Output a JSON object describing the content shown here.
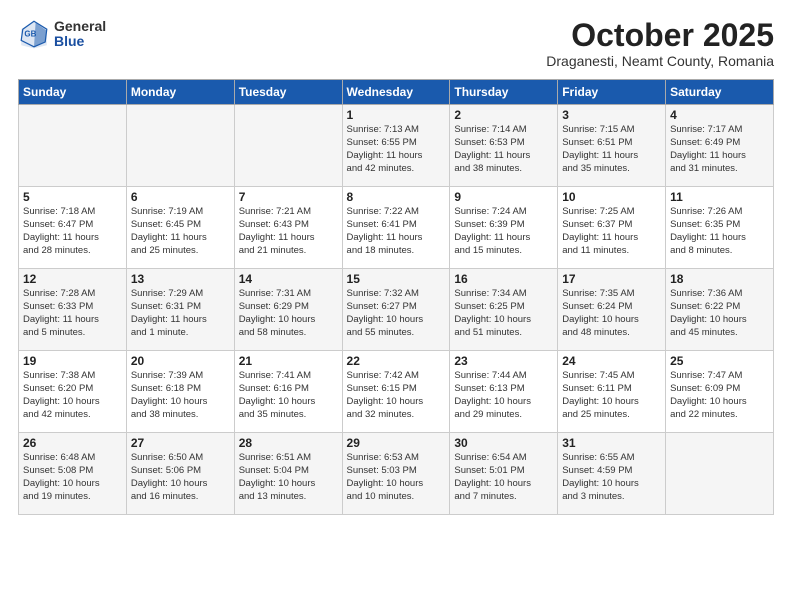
{
  "header": {
    "logo_general": "General",
    "logo_blue": "Blue",
    "month": "October 2025",
    "location": "Draganesti, Neamt County, Romania"
  },
  "weekdays": [
    "Sunday",
    "Monday",
    "Tuesday",
    "Wednesday",
    "Thursday",
    "Friday",
    "Saturday"
  ],
  "weeks": [
    [
      {
        "day": "",
        "lines": []
      },
      {
        "day": "",
        "lines": []
      },
      {
        "day": "",
        "lines": []
      },
      {
        "day": "1",
        "lines": [
          "Sunrise: 7:13 AM",
          "Sunset: 6:55 PM",
          "Daylight: 11 hours",
          "and 42 minutes."
        ]
      },
      {
        "day": "2",
        "lines": [
          "Sunrise: 7:14 AM",
          "Sunset: 6:53 PM",
          "Daylight: 11 hours",
          "and 38 minutes."
        ]
      },
      {
        "day": "3",
        "lines": [
          "Sunrise: 7:15 AM",
          "Sunset: 6:51 PM",
          "Daylight: 11 hours",
          "and 35 minutes."
        ]
      },
      {
        "day": "4",
        "lines": [
          "Sunrise: 7:17 AM",
          "Sunset: 6:49 PM",
          "Daylight: 11 hours",
          "and 31 minutes."
        ]
      }
    ],
    [
      {
        "day": "5",
        "lines": [
          "Sunrise: 7:18 AM",
          "Sunset: 6:47 PM",
          "Daylight: 11 hours",
          "and 28 minutes."
        ]
      },
      {
        "day": "6",
        "lines": [
          "Sunrise: 7:19 AM",
          "Sunset: 6:45 PM",
          "Daylight: 11 hours",
          "and 25 minutes."
        ]
      },
      {
        "day": "7",
        "lines": [
          "Sunrise: 7:21 AM",
          "Sunset: 6:43 PM",
          "Daylight: 11 hours",
          "and 21 minutes."
        ]
      },
      {
        "day": "8",
        "lines": [
          "Sunrise: 7:22 AM",
          "Sunset: 6:41 PM",
          "Daylight: 11 hours",
          "and 18 minutes."
        ]
      },
      {
        "day": "9",
        "lines": [
          "Sunrise: 7:24 AM",
          "Sunset: 6:39 PM",
          "Daylight: 11 hours",
          "and 15 minutes."
        ]
      },
      {
        "day": "10",
        "lines": [
          "Sunrise: 7:25 AM",
          "Sunset: 6:37 PM",
          "Daylight: 11 hours",
          "and 11 minutes."
        ]
      },
      {
        "day": "11",
        "lines": [
          "Sunrise: 7:26 AM",
          "Sunset: 6:35 PM",
          "Daylight: 11 hours",
          "and 8 minutes."
        ]
      }
    ],
    [
      {
        "day": "12",
        "lines": [
          "Sunrise: 7:28 AM",
          "Sunset: 6:33 PM",
          "Daylight: 11 hours",
          "and 5 minutes."
        ]
      },
      {
        "day": "13",
        "lines": [
          "Sunrise: 7:29 AM",
          "Sunset: 6:31 PM",
          "Daylight: 11 hours",
          "and 1 minute."
        ]
      },
      {
        "day": "14",
        "lines": [
          "Sunrise: 7:31 AM",
          "Sunset: 6:29 PM",
          "Daylight: 10 hours",
          "and 58 minutes."
        ]
      },
      {
        "day": "15",
        "lines": [
          "Sunrise: 7:32 AM",
          "Sunset: 6:27 PM",
          "Daylight: 10 hours",
          "and 55 minutes."
        ]
      },
      {
        "day": "16",
        "lines": [
          "Sunrise: 7:34 AM",
          "Sunset: 6:25 PM",
          "Daylight: 10 hours",
          "and 51 minutes."
        ]
      },
      {
        "day": "17",
        "lines": [
          "Sunrise: 7:35 AM",
          "Sunset: 6:24 PM",
          "Daylight: 10 hours",
          "and 48 minutes."
        ]
      },
      {
        "day": "18",
        "lines": [
          "Sunrise: 7:36 AM",
          "Sunset: 6:22 PM",
          "Daylight: 10 hours",
          "and 45 minutes."
        ]
      }
    ],
    [
      {
        "day": "19",
        "lines": [
          "Sunrise: 7:38 AM",
          "Sunset: 6:20 PM",
          "Daylight: 10 hours",
          "and 42 minutes."
        ]
      },
      {
        "day": "20",
        "lines": [
          "Sunrise: 7:39 AM",
          "Sunset: 6:18 PM",
          "Daylight: 10 hours",
          "and 38 minutes."
        ]
      },
      {
        "day": "21",
        "lines": [
          "Sunrise: 7:41 AM",
          "Sunset: 6:16 PM",
          "Daylight: 10 hours",
          "and 35 minutes."
        ]
      },
      {
        "day": "22",
        "lines": [
          "Sunrise: 7:42 AM",
          "Sunset: 6:15 PM",
          "Daylight: 10 hours",
          "and 32 minutes."
        ]
      },
      {
        "day": "23",
        "lines": [
          "Sunrise: 7:44 AM",
          "Sunset: 6:13 PM",
          "Daylight: 10 hours",
          "and 29 minutes."
        ]
      },
      {
        "day": "24",
        "lines": [
          "Sunrise: 7:45 AM",
          "Sunset: 6:11 PM",
          "Daylight: 10 hours",
          "and 25 minutes."
        ]
      },
      {
        "day": "25",
        "lines": [
          "Sunrise: 7:47 AM",
          "Sunset: 6:09 PM",
          "Daylight: 10 hours",
          "and 22 minutes."
        ]
      }
    ],
    [
      {
        "day": "26",
        "lines": [
          "Sunrise: 6:48 AM",
          "Sunset: 5:08 PM",
          "Daylight: 10 hours",
          "and 19 minutes."
        ]
      },
      {
        "day": "27",
        "lines": [
          "Sunrise: 6:50 AM",
          "Sunset: 5:06 PM",
          "Daylight: 10 hours",
          "and 16 minutes."
        ]
      },
      {
        "day": "28",
        "lines": [
          "Sunrise: 6:51 AM",
          "Sunset: 5:04 PM",
          "Daylight: 10 hours",
          "and 13 minutes."
        ]
      },
      {
        "day": "29",
        "lines": [
          "Sunrise: 6:53 AM",
          "Sunset: 5:03 PM",
          "Daylight: 10 hours",
          "and 10 minutes."
        ]
      },
      {
        "day": "30",
        "lines": [
          "Sunrise: 6:54 AM",
          "Sunset: 5:01 PM",
          "Daylight: 10 hours",
          "and 7 minutes."
        ]
      },
      {
        "day": "31",
        "lines": [
          "Sunrise: 6:55 AM",
          "Sunset: 4:59 PM",
          "Daylight: 10 hours",
          "and 3 minutes."
        ]
      },
      {
        "day": "",
        "lines": []
      }
    ]
  ]
}
